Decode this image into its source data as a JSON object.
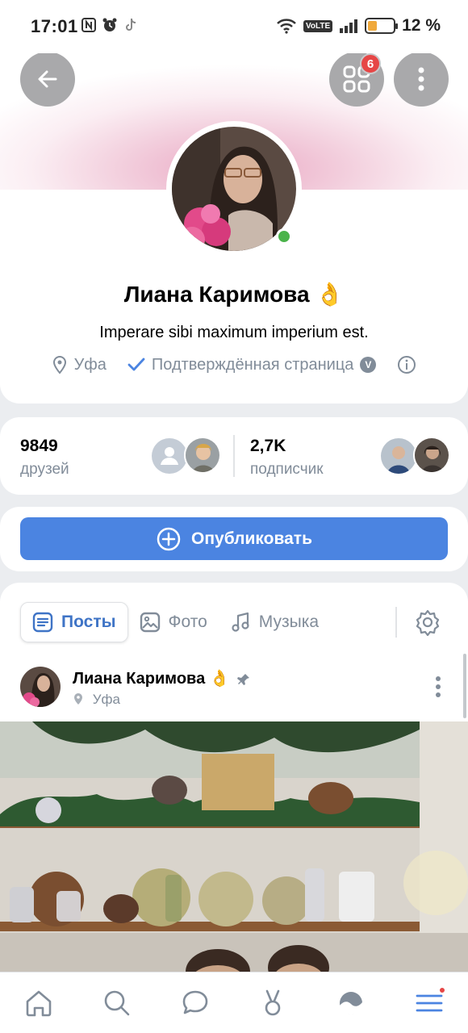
{
  "status_bar": {
    "time": "17:01",
    "network": "VoLTE",
    "battery_percent": "12 %",
    "battery_level": 0.12
  },
  "header": {
    "apps_badge": "6"
  },
  "profile": {
    "name": "Лиана Каримова",
    "name_emoji": "👌",
    "status": "Imperare sibi maximum imperium est.",
    "city": "Уфа",
    "verified_label": "Подтверждённая страница",
    "verified_badge": "V",
    "online": true
  },
  "stats": {
    "friends_count": "9849",
    "friends_label": "друзей",
    "followers_count": "2,7K",
    "followers_label": "подписчик"
  },
  "publish": {
    "label": "Опубликовать"
  },
  "tabs": [
    {
      "label": "Посты",
      "icon": "posts-icon",
      "active": true
    },
    {
      "label": "Фото",
      "icon": "photo-icon",
      "active": false
    },
    {
      "label": "Музыка",
      "icon": "music-icon",
      "active": false
    }
  ],
  "post": {
    "author": "Лиана Каримова",
    "author_emoji": "👌",
    "location": "Уфа",
    "pinned": true
  },
  "colors": {
    "accent": "#4b84e1",
    "active_tab": "#3f74c6",
    "secondary_text": "#818c99",
    "online": "#4bb34b",
    "badge": "#e64646"
  },
  "bottom_nav": [
    {
      "name": "home-icon"
    },
    {
      "name": "search-icon"
    },
    {
      "name": "messages-icon"
    },
    {
      "name": "clips-icon"
    },
    {
      "name": "services-icon"
    },
    {
      "name": "menu-icon"
    }
  ]
}
